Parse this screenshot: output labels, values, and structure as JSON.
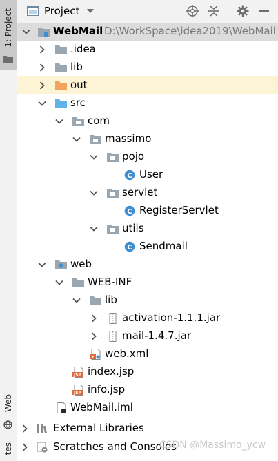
{
  "sidebar": {
    "project_tab": "1: Project",
    "web_tab": "Web",
    "structure_tab": "tes"
  },
  "header": {
    "title": "Project"
  },
  "tree": {
    "root_name": "WebMail",
    "root_path": "D:\\WorkSpace\\idea2019\\WebMail",
    "idea": ".idea",
    "lib": "lib",
    "out": "out",
    "src": "src",
    "com": "com",
    "massimo": "massimo",
    "pojo": "pojo",
    "user": "User",
    "servlet": "servlet",
    "register_servlet": "RegisterServlet",
    "utils": "utils",
    "sendmail": "Sendmail",
    "web": "web",
    "web_inf": "WEB-INF",
    "web_inf_lib": "lib",
    "activation_jar": "activation-1.1.1.jar",
    "mail_jar": "mail-1.4.7.jar",
    "web_xml": "web.xml",
    "index_jsp": "index.jsp",
    "info_jsp": "info.jsp",
    "webmail_iml": "WebMail.iml",
    "external_libraries": "External Libraries",
    "scratches": "Scratches and Consoles"
  },
  "watermark": "CSDN @Massimo_ycw",
  "colors": {
    "folder_gray": "#9aa7b0",
    "folder_orange": "#f4a35c",
    "folder_blue": "#5fb3e6",
    "class_blue": "#3d8fd1",
    "highlight": "#fdf4d6"
  }
}
